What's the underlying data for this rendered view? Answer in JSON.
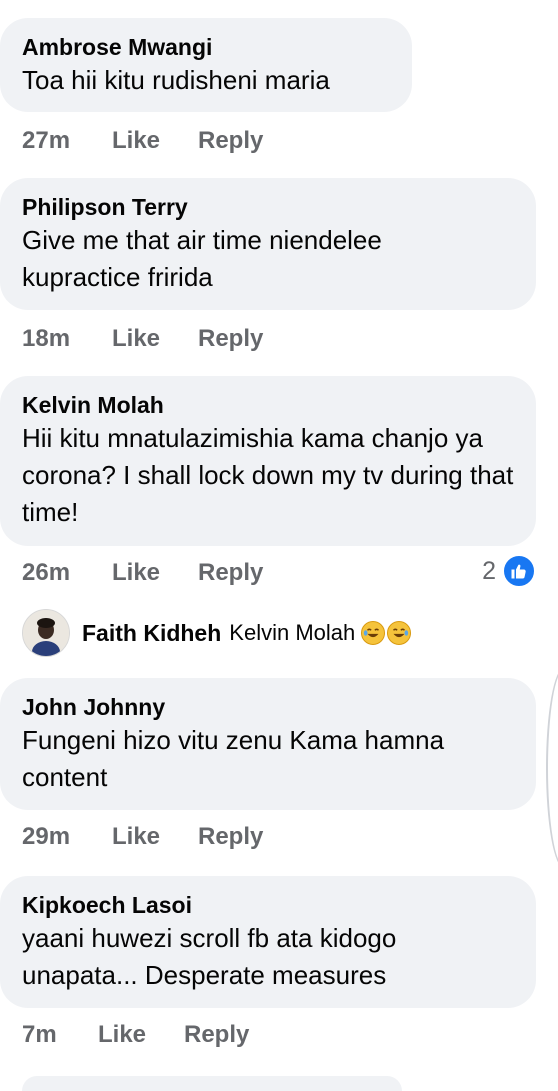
{
  "comments": [
    {
      "author": "Ambrose Mwangi",
      "text": "Toa hii kitu rudisheni maria",
      "time": "27m",
      "like_label": "Like",
      "reply_label": "Reply"
    },
    {
      "author": "Philipson Terry",
      "text": "Give me that air time niendelee kupractice fririda",
      "time": "18m",
      "like_label": "Like",
      "reply_label": "Reply"
    },
    {
      "author": "Kelvin Molah",
      "text": "Hii kitu mnatulazimishia kama chanjo ya corona?  I shall lock down my tv during that time!",
      "time": "26m",
      "like_label": "Like",
      "reply_label": "Reply",
      "reaction_count": "2",
      "reaction_icon": "thumbs-up-icon"
    },
    {
      "author": "John Johnny",
      "text": "Fungeni hizo vitu zenu Kama hamna content",
      "time": "29m",
      "like_label": "Like",
      "reply_label": "Reply"
    },
    {
      "author": "Kipkoech Lasoi",
      "text": "yaani huwezi scroll fb ata kidogo unapata... Desperate measures",
      "time": "7m",
      "like_label": "Like",
      "reply_label": "Reply"
    }
  ],
  "reply_preview": {
    "author": "Faith Kidheh",
    "mention": "Kelvin Molah",
    "emojis": [
      "rolling-on-floor-laughing-icon",
      "rolling-on-floor-laughing-icon"
    ]
  },
  "colors": {
    "bubble_bg": "#f0f2f5",
    "meta_text": "#65676b",
    "like_blue": "#1877f2"
  }
}
